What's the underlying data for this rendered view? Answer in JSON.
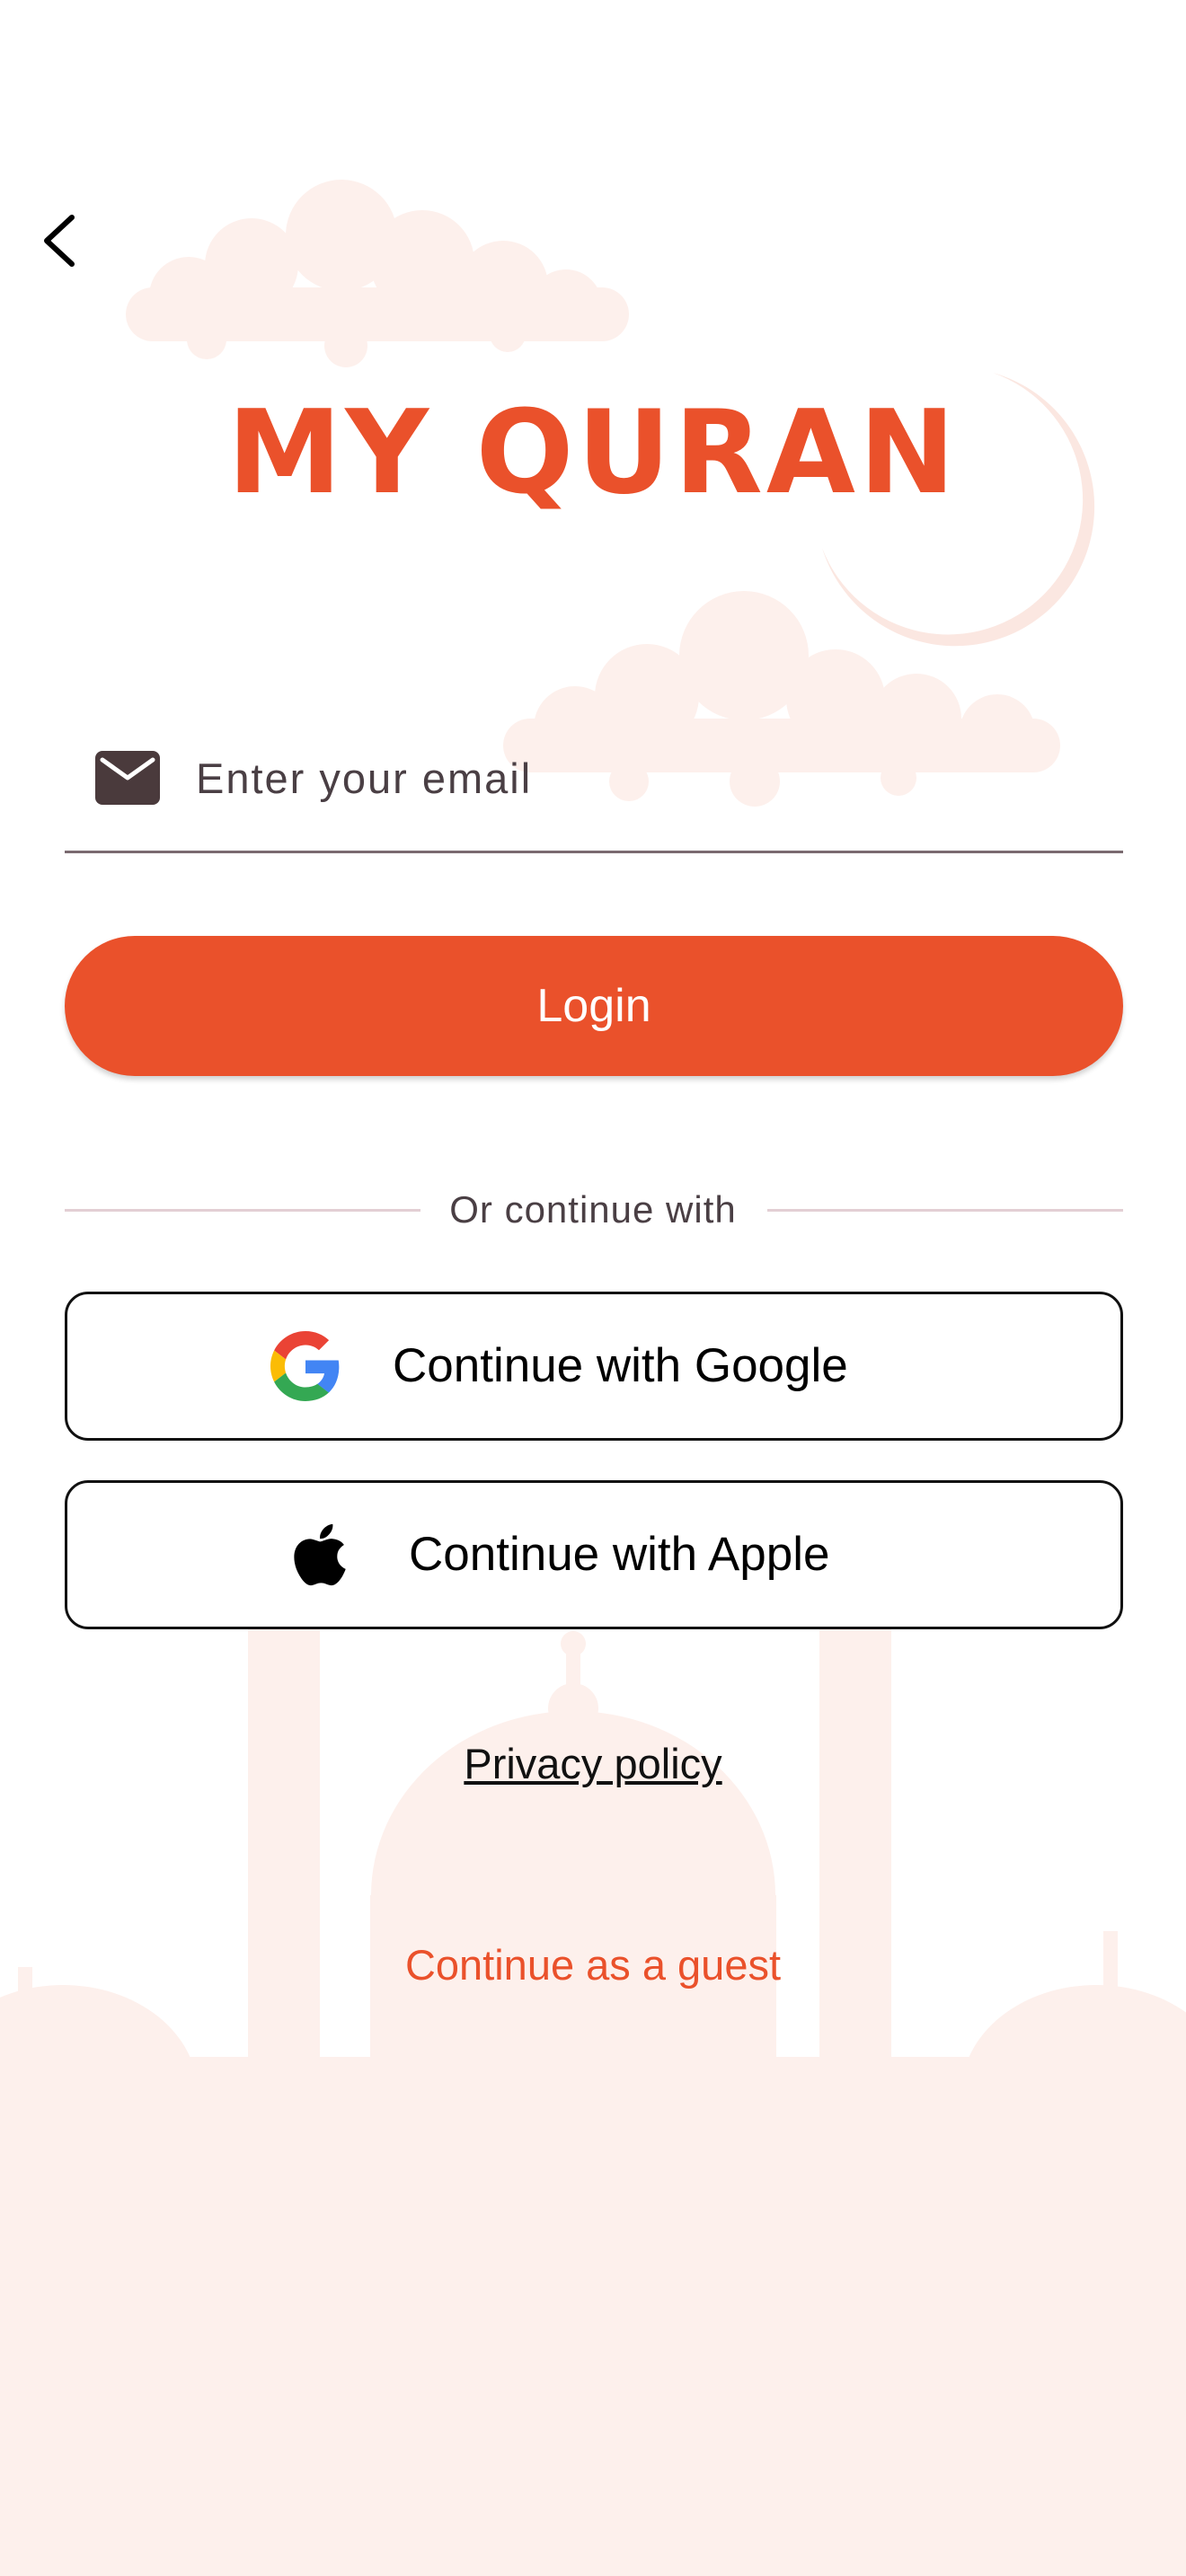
{
  "app": {
    "title": "MY QURAN"
  },
  "email": {
    "placeholder": "Enter your email",
    "value": ""
  },
  "login": {
    "label": "Login"
  },
  "divider": {
    "text": "Or continue with"
  },
  "social": {
    "google_label": "Continue with Google",
    "apple_label": "Continue with Apple"
  },
  "links": {
    "privacy": "Privacy policy",
    "guest": "Continue as a guest"
  },
  "icons": {
    "back": "chevron-left-icon",
    "email": "envelope-icon",
    "google": "google-icon",
    "apple": "apple-icon"
  },
  "colors": {
    "accent": "#EA512B",
    "background_art": "#FDF0EC",
    "text_primary": "#000000",
    "text_secondary": "#4A3F44"
  }
}
